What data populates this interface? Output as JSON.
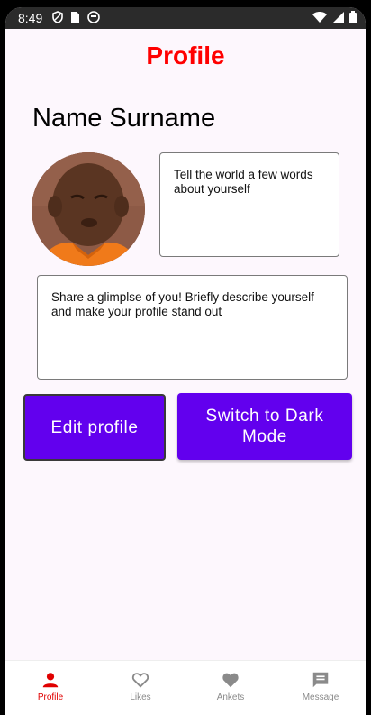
{
  "status_bar": {
    "time": "8:49"
  },
  "page": {
    "title": "Profile"
  },
  "profile": {
    "name": "Name Surname",
    "about_placeholder": "Tell the world a few words about yourself",
    "glimpse_placeholder": "Share a glimplse of you! Briefly describe yourself and make your profile stand out"
  },
  "buttons": {
    "edit_profile": "Edit profile",
    "dark_mode": "Switch to Dark Mode"
  },
  "bottom_nav": {
    "items": [
      {
        "label": "Profile",
        "icon": "person-icon",
        "active": true
      },
      {
        "label": "Likes",
        "icon": "heart-outline-icon",
        "active": false
      },
      {
        "label": "Ankets",
        "icon": "heart-filled-icon",
        "active": false
      },
      {
        "label": "Message",
        "icon": "chat-icon",
        "active": false
      }
    ]
  },
  "colors": {
    "accent": "#6200ee",
    "title": "#ff0000",
    "nav_active": "#e00000",
    "nav_inactive": "#8a8a8a"
  }
}
